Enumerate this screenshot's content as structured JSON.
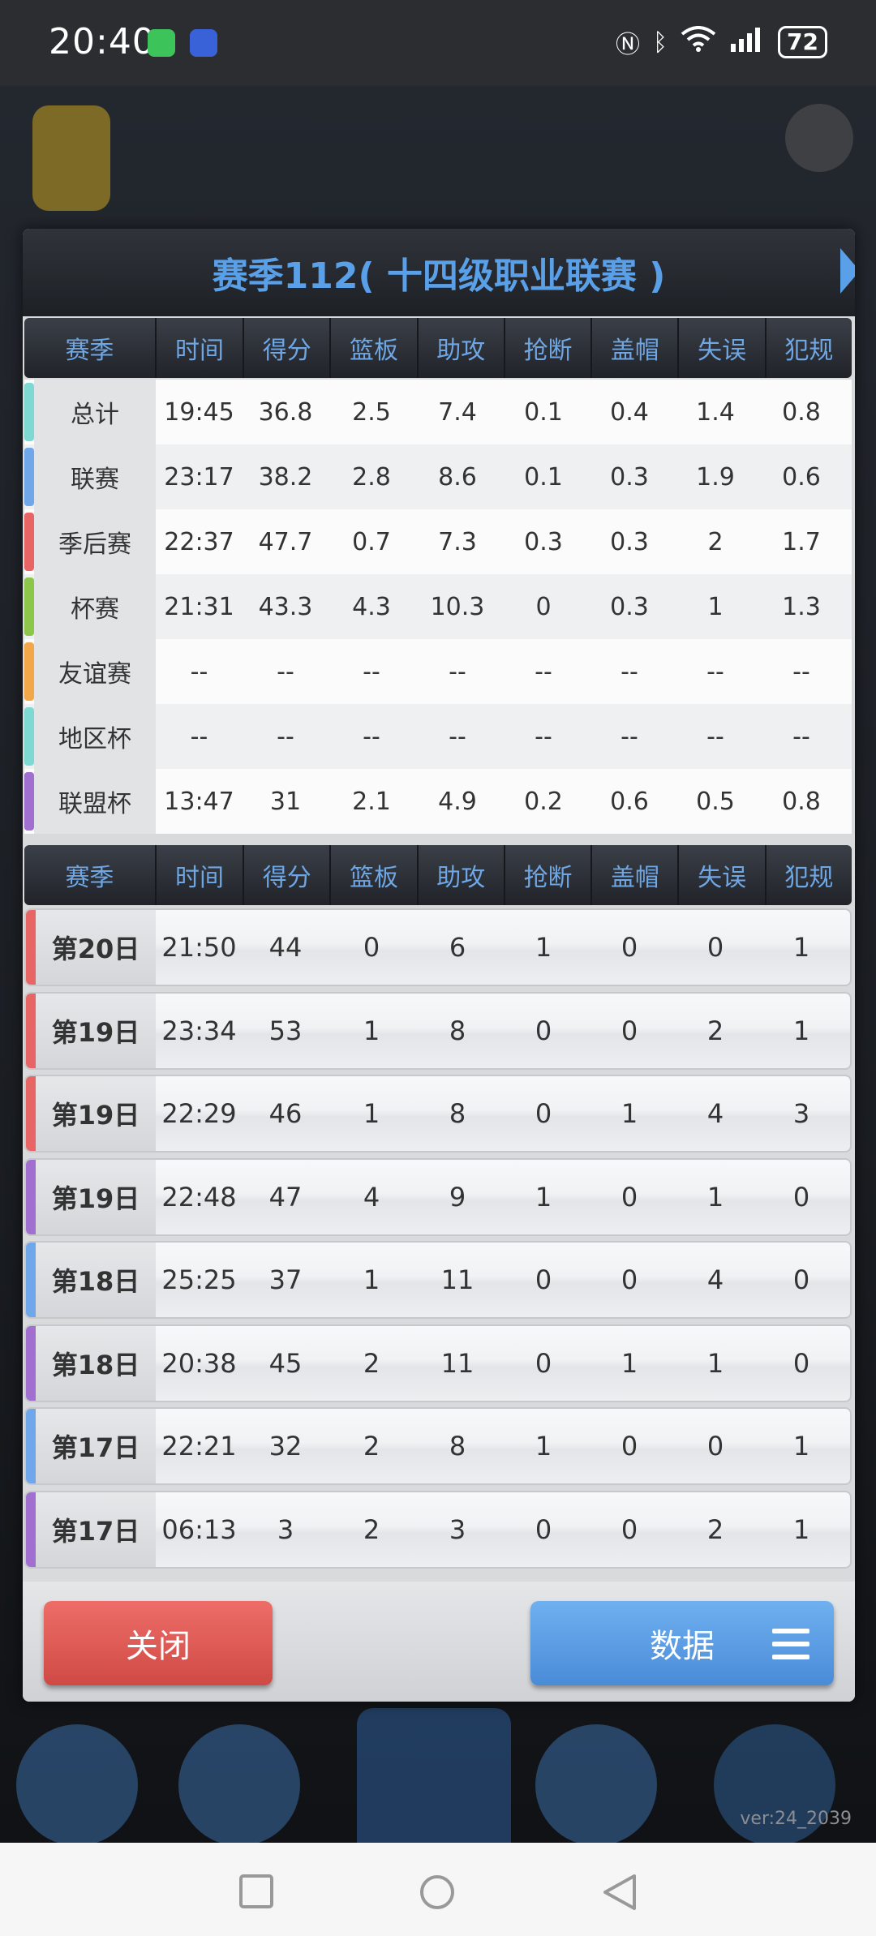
{
  "status_bar": {
    "time": "20:40",
    "battery": "72"
  },
  "dialog": {
    "title": "赛季112( 十四级职业联赛 )",
    "columns": [
      "赛季",
      "时间",
      "得分",
      "篮板",
      "助攻",
      "抢断",
      "盖帽",
      "失误",
      "犯规"
    ],
    "summary_rows": [
      {
        "label": "总计",
        "color": "#7ed9d2",
        "values": [
          "19:45",
          "36.8",
          "2.5",
          "7.4",
          "0.1",
          "0.4",
          "1.4",
          "0.8"
        ]
      },
      {
        "label": "联赛",
        "color": "#6fa7ea",
        "values": [
          "23:17",
          "38.2",
          "2.8",
          "8.6",
          "0.1",
          "0.3",
          "1.9",
          "0.6"
        ]
      },
      {
        "label": "季后赛",
        "color": "#e86565",
        "values": [
          "22:37",
          "47.7",
          "0.7",
          "7.3",
          "0.3",
          "0.3",
          "2",
          "1.7"
        ]
      },
      {
        "label": "杯赛",
        "color": "#8cc64a",
        "values": [
          "21:31",
          "43.3",
          "4.3",
          "10.3",
          "0",
          "0.3",
          "1",
          "1.3"
        ]
      },
      {
        "label": "友谊赛",
        "color": "#f2a84a",
        "values": [
          "--",
          "--",
          "--",
          "--",
          "--",
          "--",
          "--",
          "--"
        ]
      },
      {
        "label": "地区杯",
        "color": "#7ed9d2",
        "values": [
          "--",
          "--",
          "--",
          "--",
          "--",
          "--",
          "--",
          "--"
        ]
      },
      {
        "label": "联盟杯",
        "color": "#a06fd0",
        "values": [
          "13:47",
          "31",
          "2.1",
          "4.9",
          "0.2",
          "0.6",
          "0.5",
          "0.8"
        ]
      }
    ],
    "game_rows": [
      {
        "label": "第20日",
        "color": "#e86565",
        "values": [
          "21:50",
          "44",
          "0",
          "6",
          "1",
          "0",
          "0",
          "1"
        ]
      },
      {
        "label": "第19日",
        "color": "#e86565",
        "values": [
          "23:34",
          "53",
          "1",
          "8",
          "0",
          "0",
          "2",
          "1"
        ]
      },
      {
        "label": "第19日",
        "color": "#e86565",
        "values": [
          "22:29",
          "46",
          "1",
          "8",
          "0",
          "1",
          "4",
          "3"
        ]
      },
      {
        "label": "第19日",
        "color": "#a06fd0",
        "values": [
          "22:48",
          "47",
          "4",
          "9",
          "1",
          "0",
          "1",
          "0"
        ]
      },
      {
        "label": "第18日",
        "color": "#6fa7ea",
        "values": [
          "25:25",
          "37",
          "1",
          "11",
          "0",
          "0",
          "4",
          "0"
        ]
      },
      {
        "label": "第18日",
        "color": "#a06fd0",
        "values": [
          "20:38",
          "45",
          "2",
          "11",
          "0",
          "1",
          "1",
          "0"
        ]
      },
      {
        "label": "第17日",
        "color": "#6fa7ea",
        "values": [
          "22:21",
          "32",
          "2",
          "8",
          "1",
          "0",
          "0",
          "1"
        ]
      },
      {
        "label": "第17日",
        "color": "#a06fd0",
        "values": [
          "06:13",
          "3",
          "2",
          "3",
          "0",
          "0",
          "2",
          "1"
        ]
      }
    ],
    "close_label": "关闭",
    "data_label": "数据"
  },
  "version": "ver:24_2039"
}
